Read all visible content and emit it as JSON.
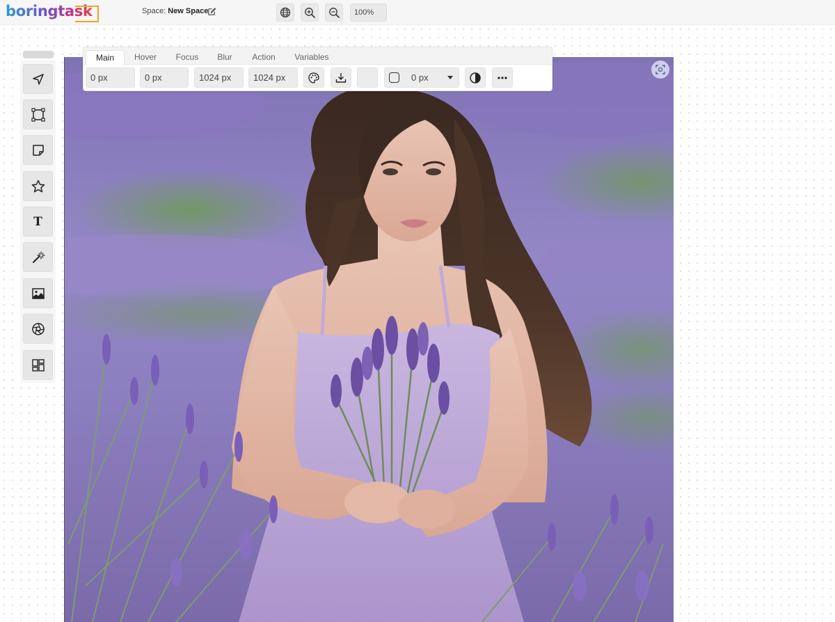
{
  "app": {
    "logo_text": "boringtask",
    "space_label": "Space:",
    "space_name": "New Space",
    "zoom_value": "100%"
  },
  "toolbar_icons": [
    "globe-icon",
    "zoom-in-icon",
    "zoom-out-icon"
  ],
  "left_tools": [
    {
      "name": "select-tool",
      "icon": "pointer-arrow-icon"
    },
    {
      "name": "frame-tool",
      "icon": "frame-icon"
    },
    {
      "name": "sticky-note-tool",
      "icon": "sticky-note-icon"
    },
    {
      "name": "shape-tool",
      "icon": "star-icon"
    },
    {
      "name": "text-tool",
      "icon": "text-icon",
      "label": "T"
    },
    {
      "name": "ai-generate-tool",
      "icon": "magic-wand-icon"
    },
    {
      "name": "image-tool",
      "icon": "image-icon"
    },
    {
      "name": "camera-tool",
      "icon": "aperture-icon"
    },
    {
      "name": "components-tool",
      "icon": "grid-layout-icon"
    }
  ],
  "properties": {
    "tabs": [
      "Main",
      "Hover",
      "Focus",
      "Blur",
      "Action",
      "Variables"
    ],
    "active_tab": "Main",
    "x": "0 px",
    "y": "0 px",
    "width": "1024 px",
    "height": "1024 px",
    "corner_radius": "0 px",
    "icons": [
      "palette-icon",
      "download-icon",
      "fill-swatch",
      "corner-radius-icon",
      "contrast-icon",
      "more-options-icon"
    ]
  },
  "canvas": {
    "image_alt": "Woman in lavender dress holding a lavender bouquet in a lavender field"
  },
  "colors": {
    "lavender": "#9a86c9",
    "accent_orange": "#f2a516"
  }
}
